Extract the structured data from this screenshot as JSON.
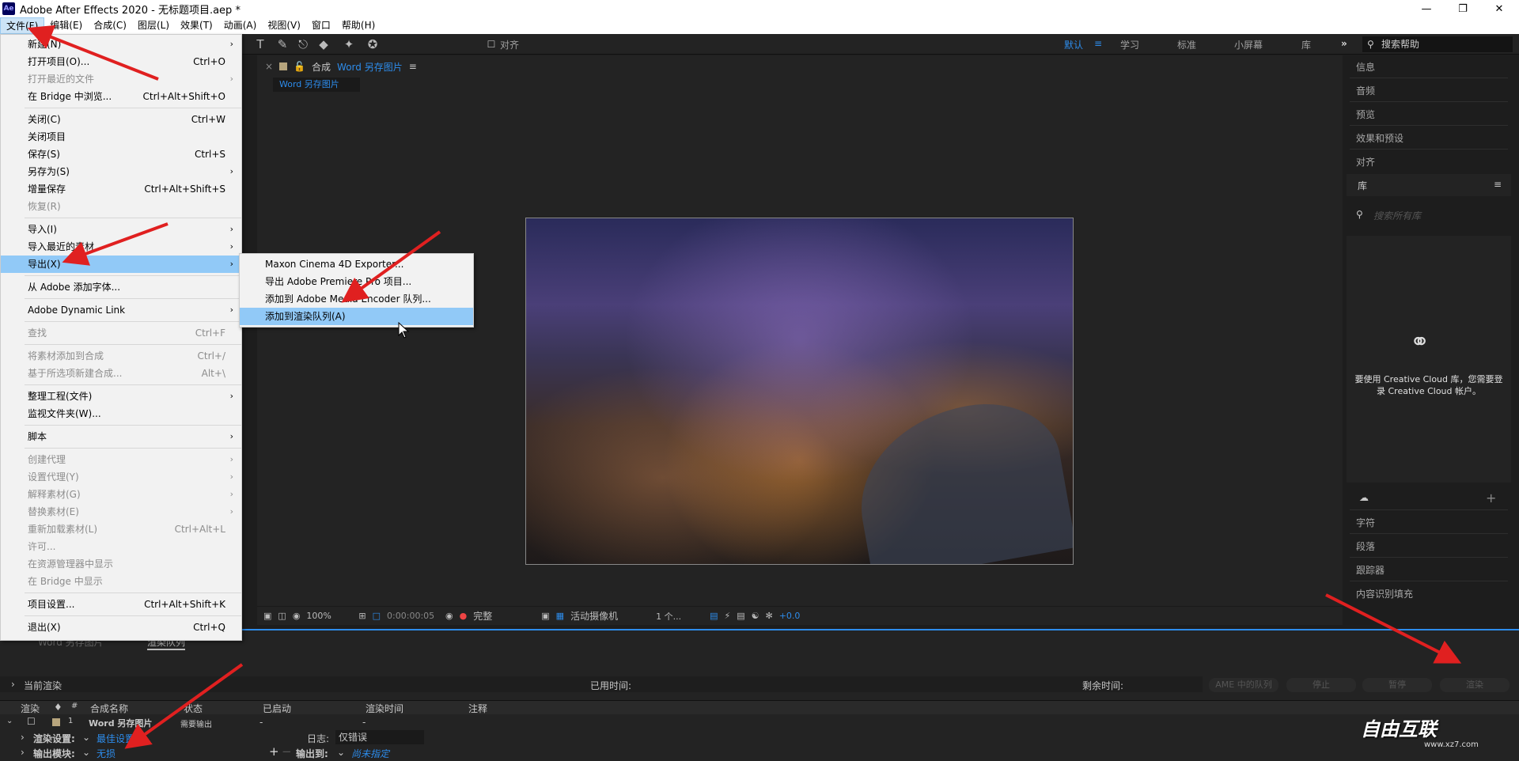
{
  "title": "Adobe After Effects 2020 - 无标题项目.aep *",
  "logo": "Ae",
  "menubar": [
    "文件(F)",
    "编辑(E)",
    "合成(C)",
    "图层(L)",
    "效果(T)",
    "动画(A)",
    "视图(V)",
    "窗口",
    "帮助(H)"
  ],
  "workspaces": {
    "active": "默认",
    "items": [
      "学习",
      "标准",
      "小屏幕",
      "库"
    ],
    "more": "»"
  },
  "toolbar": {
    "snap_label": "对齐"
  },
  "search_help": "搜索帮助",
  "comp": {
    "tab_prefix": "合成",
    "tab_name": "Word 另存图片",
    "crumb": "Word 另存图片"
  },
  "viewer_toolbar": {
    "zoom": "100%",
    "timecode": "0:00:00:05",
    "resolution": "完整",
    "camera": "活动摄像机",
    "views": "1 个...",
    "exposure": "+0.0"
  },
  "right_panel": {
    "items": [
      "信息",
      "音频",
      "预览",
      "效果和预设",
      "对齐"
    ],
    "library_title": "库",
    "library_search_placeholder": "搜索所有库",
    "cc_message_1": "要使用 Creative Cloud 库，您需要登",
    "cc_message_2": "录 Creative Cloud 帐户。",
    "bottom_items": [
      "字符",
      "段落",
      "跟踪器",
      "内容识别填充"
    ]
  },
  "render_queue": {
    "tabs": [
      "Word 另存图片",
      "渲染队列"
    ],
    "current_render": "当前渲染",
    "elapsed": "已用时间:",
    "remaining": "剩余时间:",
    "buttons": [
      "AME 中的队列",
      "停止",
      "暂停",
      "渲染"
    ],
    "columns": [
      "渲染",
      "#",
      "合成名称",
      "状态",
      "已启动",
      "渲染时间",
      "注释"
    ],
    "row": {
      "index": "1",
      "name": "Word 另存图片",
      "status": "需要输出",
      "started": "-",
      "time": "-"
    },
    "render_settings_label": "渲染设置:",
    "render_settings_value": "最佳设置",
    "log_label": "日志:",
    "log_value": "仅错误",
    "output_module_label": "输出模块:",
    "output_module_value": "无损",
    "output_to_label": "输出到:",
    "output_to_value": "尚未指定"
  },
  "file_menu": [
    {
      "label": "新建(N)",
      "arrow": true
    },
    {
      "label": "打开项目(O)...",
      "sc": "Ctrl+O"
    },
    {
      "label": "打开最近的文件",
      "arrow": true,
      "dis": true
    },
    {
      "label": "在 Bridge 中浏览...",
      "sc": "Ctrl+Alt+Shift+O"
    },
    {
      "sep": true
    },
    {
      "label": "关闭(C)",
      "sc": "Ctrl+W"
    },
    {
      "label": "关闭项目"
    },
    {
      "label": "保存(S)",
      "sc": "Ctrl+S"
    },
    {
      "label": "另存为(S)",
      "arrow": true
    },
    {
      "label": "增量保存",
      "sc": "Ctrl+Alt+Shift+S"
    },
    {
      "label": "恢复(R)",
      "dis": true
    },
    {
      "sep": true
    },
    {
      "label": "导入(I)",
      "arrow": true
    },
    {
      "label": "导入最近的素材",
      "arrow": true
    },
    {
      "label": "导出(X)",
      "arrow": true,
      "hl": true
    },
    {
      "sep": true
    },
    {
      "label": "从 Adobe 添加字体..."
    },
    {
      "sep": true
    },
    {
      "label": "Adobe Dynamic Link",
      "arrow": true
    },
    {
      "sep": true
    },
    {
      "label": "查找",
      "sc": "Ctrl+F",
      "dis": true
    },
    {
      "sep": true
    },
    {
      "label": "将素材添加到合成",
      "sc": "Ctrl+/",
      "dis": true
    },
    {
      "label": "基于所选项新建合成...",
      "sc": "Alt+\\",
      "dis": true
    },
    {
      "sep": true
    },
    {
      "label": "整理工程(文件)",
      "arrow": true
    },
    {
      "label": "监视文件夹(W)..."
    },
    {
      "sep": true
    },
    {
      "label": "脚本",
      "arrow": true
    },
    {
      "sep": true
    },
    {
      "label": "创建代理",
      "arrow": true,
      "dis": true
    },
    {
      "label": "设置代理(Y)",
      "arrow": true,
      "dis": true
    },
    {
      "label": "解释素材(G)",
      "arrow": true,
      "dis": true
    },
    {
      "label": "替换素材(E)",
      "arrow": true,
      "dis": true
    },
    {
      "label": "重新加载素材(L)",
      "sc": "Ctrl+Alt+L",
      "dis": true
    },
    {
      "label": "许可...",
      "dis": true
    },
    {
      "label": "在资源管理器中显示",
      "dis": true
    },
    {
      "label": "在 Bridge 中显示",
      "dis": true
    },
    {
      "sep": true
    },
    {
      "label": "项目设置...",
      "sc": "Ctrl+Alt+Shift+K"
    },
    {
      "sep": true
    },
    {
      "label": "退出(X)",
      "sc": "Ctrl+Q"
    }
  ],
  "export_submenu": [
    {
      "label": "Maxon Cinema 4D Exporter..."
    },
    {
      "label": "导出 Adobe Premiere Pro 项目..."
    },
    {
      "label": "添加到 Adobe Media Encoder 队列..."
    },
    {
      "label": "添加到渲染队列(A)",
      "hl": true
    }
  ],
  "watermark": {
    "brand": "自由互联",
    "url": "www.xz7.com"
  },
  "colors": {
    "accent": "#2d8ceb",
    "highlight": "#91c9f7",
    "annotation": "#e02020"
  }
}
